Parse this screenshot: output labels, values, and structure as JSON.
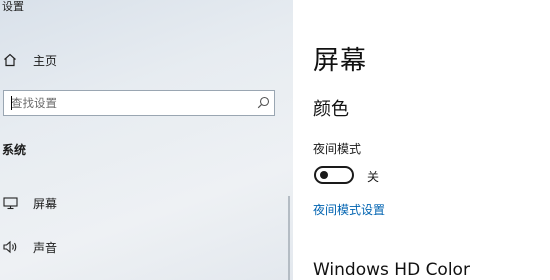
{
  "window": {
    "title": "设置"
  },
  "sidebar": {
    "home": {
      "label": "主页",
      "icon": "home-icon"
    },
    "search": {
      "placeholder": "查找设置",
      "icon": "search-icon"
    },
    "section": "系统",
    "items": [
      {
        "label": "屏幕",
        "icon": "monitor-icon"
      },
      {
        "label": "声音",
        "icon": "speaker-icon"
      }
    ]
  },
  "main": {
    "title": "屏幕",
    "color_section": "颜色",
    "night_light": {
      "label": "夜间模式",
      "state": "关",
      "on": false,
      "settings_link": "夜间模式设置"
    },
    "hdr_section": "Windows HD Color"
  },
  "colors": {
    "accent": "#0063b1",
    "sidebar_bg": "#e7ecf1"
  }
}
